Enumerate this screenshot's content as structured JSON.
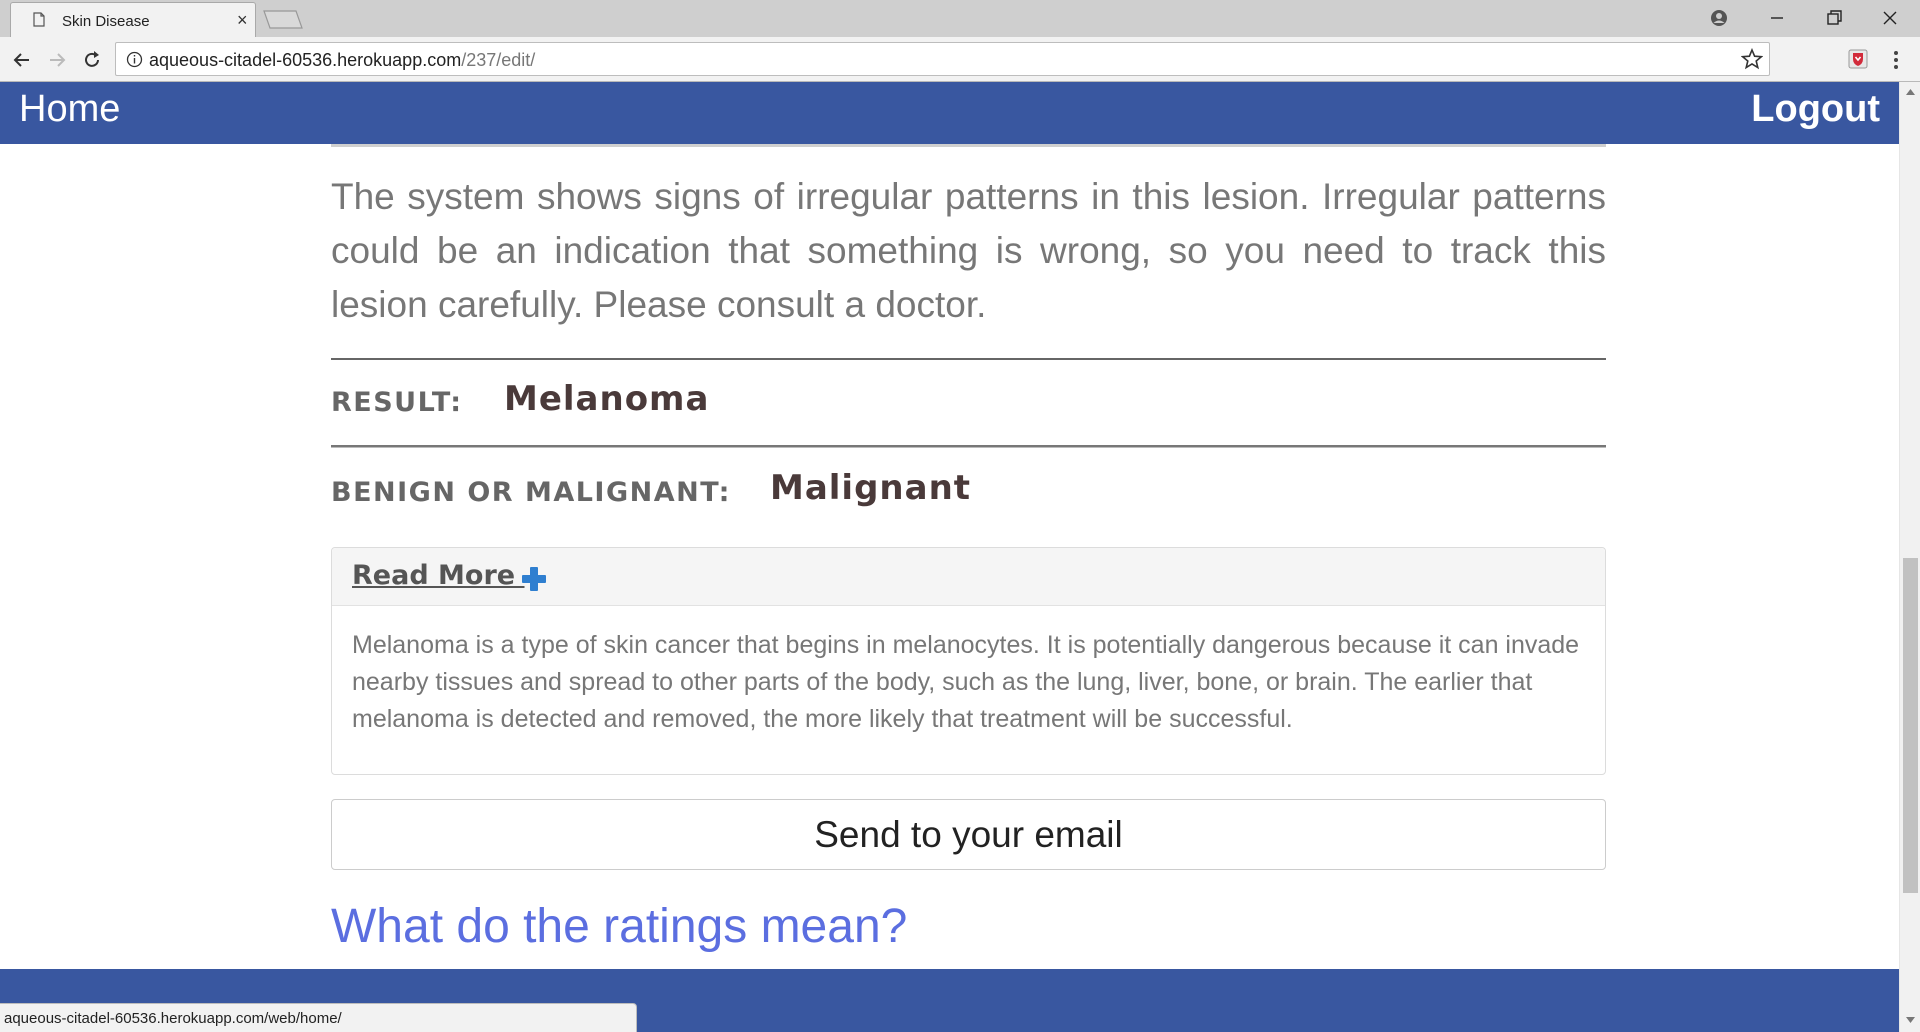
{
  "browser": {
    "tab_title": "Skin Disease",
    "tab_close_glyph": "×",
    "url_host": "aqueous-citadel-60536.herokuapp.com",
    "url_path": "/237/edit/",
    "status_url": "aqueous-citadel-60536.herokuapp.com/web/home/"
  },
  "icons": {
    "tab": "page-icon",
    "back": "back-arrow-icon",
    "forward": "forward-arrow-icon",
    "reload": "reload-icon",
    "info": "info-icon",
    "bookmark": "star-icon",
    "extension": "shield-extension-icon",
    "menu": "kebab-menu-icon",
    "read_more": "plus-icon"
  },
  "colors": {
    "navbar": "#3957a0",
    "link": "#5b6ee0",
    "plus": "#2f7fd0"
  },
  "nav": {
    "home_label": "Home",
    "logout_label": "Logout"
  },
  "main": {
    "warning_text": "The system shows signs of irregular patterns in this lesion. Irregular patterns could be an indication that something is wrong, so you need to track this lesion carefully. Please consult a doctor.",
    "result_label": "RESULT:",
    "result_value": "Melanoma",
    "bm_label": "BENIGN OR MALIGNANT:",
    "bm_value": "Malignant",
    "read_more_label": "Read More ",
    "description": "Melanoma is a type of skin cancer that begins in melanocytes. It is potentially dangerous because it can invade nearby tissues and spread to other parts of the body, such as the lung, liver, bone, or brain. The earlier that melanoma is detected and removed, the more likely that treatment will be successful.",
    "email_button_label": "Send to your email",
    "ratings_link": "What do the ratings mean?"
  }
}
